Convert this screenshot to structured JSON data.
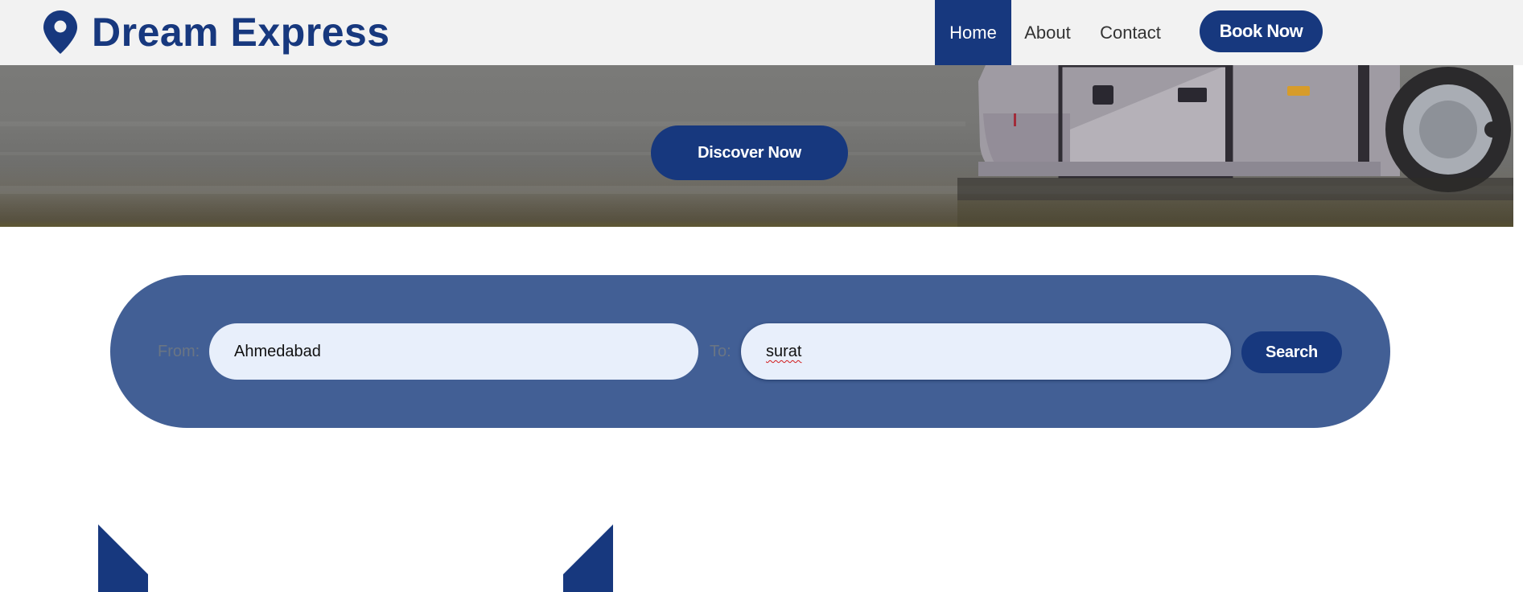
{
  "header": {
    "brand_name": "Dream Express",
    "brand_icon": "map-pin-icon",
    "nav": [
      {
        "label": "Home",
        "active": true
      },
      {
        "label": "About",
        "active": false
      },
      {
        "label": "Contact",
        "active": false
      }
    ],
    "cta_label": "Book Now"
  },
  "hero": {
    "cta_label": "Discover Now"
  },
  "search": {
    "from_label": "From:",
    "from_value": "Ahmedabad",
    "to_label": "To:",
    "to_value": "surat",
    "button_label": "Search"
  },
  "colors": {
    "primary": "#17387e",
    "panel": "#425f95",
    "input_bg": "#e8effb",
    "header_bg": "#f2f2f2"
  }
}
